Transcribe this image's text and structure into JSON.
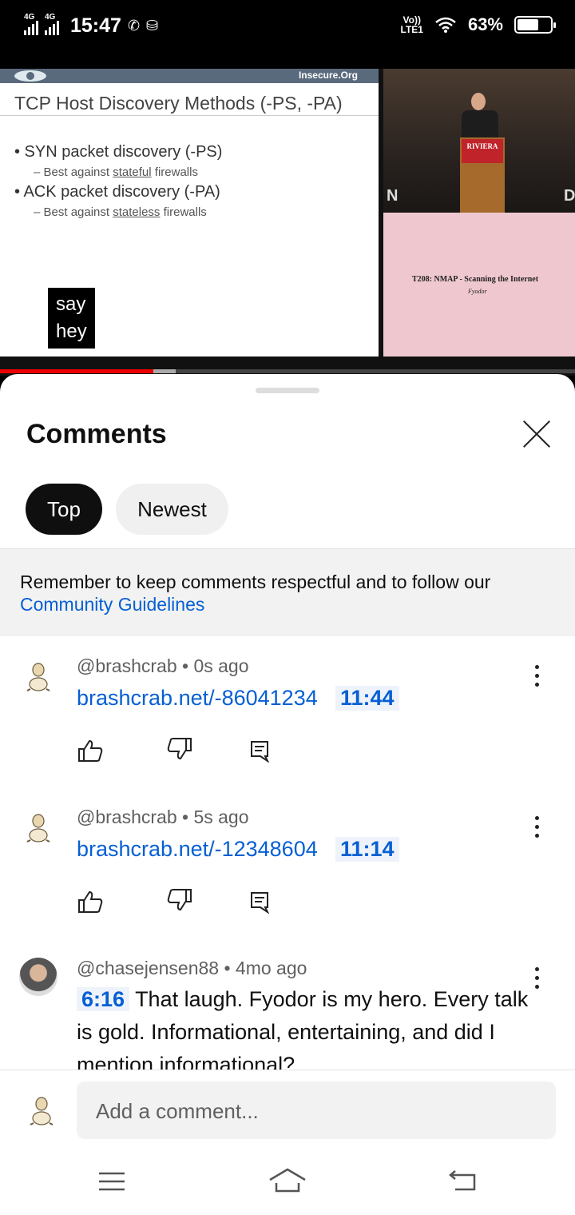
{
  "status_bar": {
    "time": "15:47",
    "network_1": "4G",
    "network_2": "4G",
    "volte_top": "Vo))",
    "volte_bottom": "LTE1",
    "battery": "63%",
    "icons": [
      "call-icon",
      "data-saver-icon",
      "wifi-icon",
      "battery-icon"
    ]
  },
  "video": {
    "slide_brand": "Insecure.Org",
    "slide_title": "TCP Host Discovery Methods (-PS, -PA)",
    "bullet_1": "• SYN packet discovery (-PS)",
    "sub_1_prefix": "– Best against ",
    "sub_1_underlined": "stateful",
    "sub_1_suffix": " firewalls",
    "bullet_2": "• ACK packet discovery (-PA)",
    "sub_2_prefix": "– Best against ",
    "sub_2_underlined": "stateless",
    "sub_2_suffix": " firewalls",
    "caption_line_1": "say",
    "caption_line_2": "hey",
    "podium_sign": "RIVIERA",
    "stage_letter_left": "N",
    "stage_letter_right": "D",
    "promo_title": "T208: NMAP - Scanning the Internet",
    "promo_subtitle": "Fyodor",
    "progress_played_fraction": 0.267
  },
  "comments_panel": {
    "title": "Comments",
    "sort_chips": [
      {
        "label": "Top",
        "selected": true
      },
      {
        "label": "Newest",
        "selected": false
      }
    ],
    "notice_text": "Remember to keep comments respectful and to follow our",
    "notice_link": "Community Guidelines",
    "comments": [
      {
        "author": "@brashcrab",
        "age": "0s ago",
        "meta": "@brashcrab • 0s ago",
        "link": "brashcrab.net/-86041234",
        "timestamp": "11:44"
      },
      {
        "author": "@brashcrab",
        "age": "5s ago",
        "meta": "@brashcrab • 5s ago",
        "link": "brashcrab.net/-12348604",
        "timestamp": "11:14"
      },
      {
        "author": "@chasejensen88",
        "age": "4mo ago",
        "meta": "@chasejensen88 • 4mo ago",
        "timestamp": "6:16",
        "text": "That laugh. Fyodor is my hero. Every talk is gold. Informational, entertaining, and did I mention informational?"
      }
    ],
    "add_comment_placeholder": "Add a comment..."
  },
  "colors": {
    "link_blue": "#065fd4",
    "progress_red": "#e00000",
    "chip_selected": "#0f0f0f"
  }
}
